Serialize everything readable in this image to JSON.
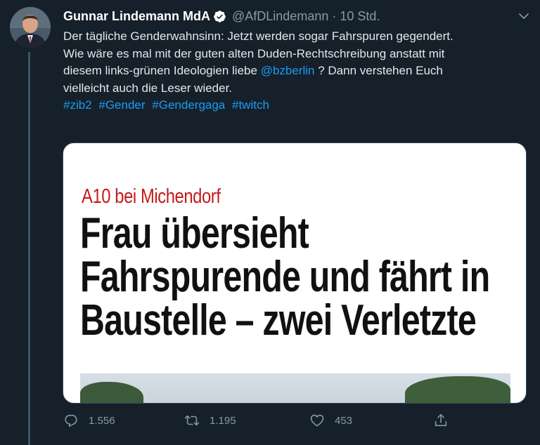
{
  "author": {
    "name": "Gunnar Lindemann MdA",
    "handle": "@AfDLindemann",
    "separator": "·",
    "time": "10 Std.",
    "verified": true
  },
  "tweet": {
    "line1": "Der tägliche Genderwahnsinn: Jetzt werden sogar Fahrspuren gegendert.",
    "line2": "Wie wäre es mal mit der guten alten Duden-Rechtschreibung anstatt mit",
    "line3_pre": "diesem links-grünen Ideologien liebe ",
    "mention": "@bzberlin",
    "line3_post": " ? Dann verstehen Euch",
    "line4": "vielleicht auch die Leser wieder.",
    "hashtags": [
      "#zib2",
      "#Gender",
      "#Gendergaga",
      "#twitch"
    ]
  },
  "card": {
    "kicker": "A10 bei Michendorf",
    "headline": [
      "Frau übersieht",
      "Fahrspurende und fährt in",
      "Baustelle – zwei Verletzte"
    ]
  },
  "actions": {
    "replies": "1.556",
    "retweets": "1.195",
    "likes": "453"
  },
  "colors": {
    "background": "#15202b",
    "link": "#1d9bf0",
    "muted": "#8899a6",
    "kicker": "#c41a1a"
  },
  "icons": [
    "verified-badge-icon",
    "chevron-down-icon",
    "reply-icon",
    "retweet-icon",
    "like-icon",
    "share-icon"
  ]
}
